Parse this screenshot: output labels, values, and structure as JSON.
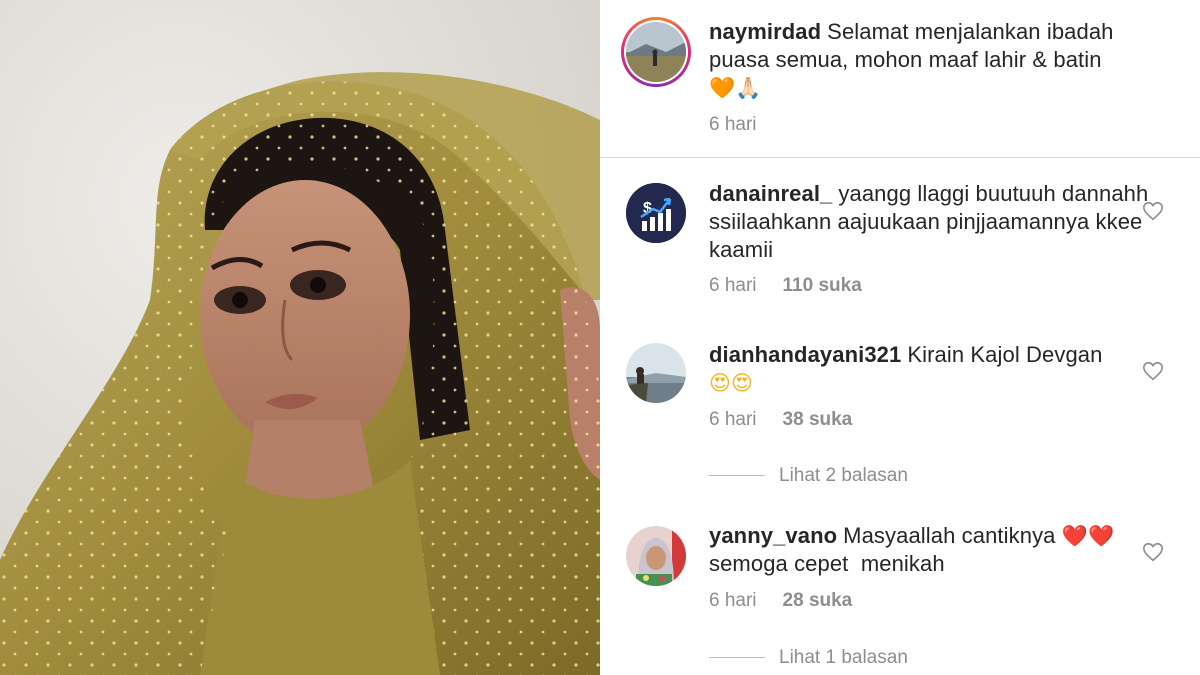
{
  "photo": {
    "description_icon": "portrait-photo"
  },
  "caption": {
    "username": "naymirdad",
    "text": "Selamat menjalankan ibadah puasa semua, mohon maaf lahir & batin",
    "emojis": "🧡🙏🏻",
    "time": "6 hari"
  },
  "comments": [
    {
      "username": "danainreal_",
      "text": "yaangg llaggi buutuuh dannahh ssiilaahkann aajuukaan pinjjaamannya kkee kaamii",
      "emojis": "",
      "time": "6 hari",
      "likes": "110 suka"
    },
    {
      "username": "dianhandayani321",
      "text": "Kirain Kajol Devgan",
      "emojis": "😍😍",
      "time": "6 hari",
      "likes": "38 suka",
      "replies": "Lihat 2 balasan"
    },
    {
      "username": "yanny_vano",
      "text": "Masyaallah cantiknya",
      "emojis": "❤️❤️",
      "text2": "semoga cepet  menikah",
      "time": "6 hari",
      "likes": "28 suka",
      "replies": "Lihat 1 balasan"
    }
  ],
  "colors": {
    "text": "#262626",
    "muted": "#8e8e8e",
    "divider": "#dbdbdb",
    "scarf": "#a8963f"
  }
}
